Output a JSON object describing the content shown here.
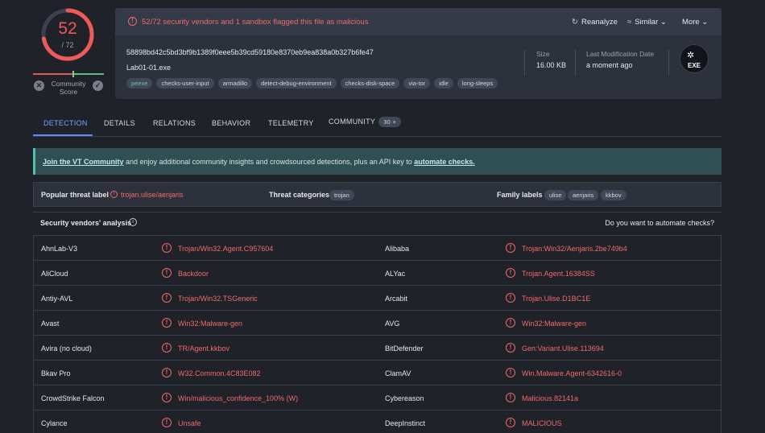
{
  "score": {
    "detected": "52",
    "total": "/ 72",
    "color": "#ef5a5a",
    "fraction": 0.722
  },
  "community": {
    "label": "Community Score"
  },
  "banner": {
    "message": "52/72 security vendors and 1 sandbox flagged this file as malicious",
    "actions": [
      {
        "icon": "reanalyze-icon",
        "glyph": "↻",
        "label": "Reanalyze"
      },
      {
        "icon": "similar-icon",
        "glyph": "≈",
        "label": "Similar ⌄"
      },
      {
        "icon": "more-icon",
        "glyph": "",
        "label": "More ⌄"
      }
    ]
  },
  "file": {
    "hash": "58898bd42c5bd3bf9b1389f0eee5b39cd59180e8370eb9ea838a0b327b6fe47",
    "name": "Lab01-01.exe",
    "tags": [
      "peexe",
      "checks-user-input",
      "armadillo",
      "detect-debug-environment",
      "checks-disk-space",
      "via-tor",
      "idle",
      "long-sleeps"
    ],
    "size_label": "Size",
    "size_value": "16.00 KB",
    "modified_label": "Last Modification Date",
    "modified_value": "a moment ago",
    "type_badge": "EXE"
  },
  "tabs": [
    {
      "label": "DETECTION"
    },
    {
      "label": "DETAILS"
    },
    {
      "label": "RELATIONS"
    },
    {
      "label": "BEHAVIOR"
    },
    {
      "label": "TELEMETRY"
    },
    {
      "label": "COMMUNITY",
      "badge": "30 +"
    }
  ],
  "join": {
    "link1": "Join the VT Community",
    "text": " and enjoy additional community insights and crowdsourced detections, plus an API key to ",
    "link2": "automate checks."
  },
  "threat": {
    "popular_label": "Popular threat label",
    "popular_value": "trojan.ulise/aenjaris",
    "categories_label": "Threat categories",
    "categories": [
      "trojan"
    ],
    "family_label": "Family labels",
    "families": [
      "ulise",
      "aenjaris",
      "kkbov"
    ]
  },
  "analysis": {
    "title": "Security vendors' analysis",
    "automate_question": "Do you want to automate checks?",
    "rows": [
      {
        "v1": "AhnLab-V3",
        "r1": "Trojan/Win32.Agent.C957604",
        "v2": "Alibaba",
        "r2": "Trojan:Win32/Aenjaris.2be749b4"
      },
      {
        "v1": "AliCloud",
        "r1": "Backdoor",
        "v2": "ALYac",
        "r2": "Trojan.Agent.16384SS"
      },
      {
        "v1": "Antiy-AVL",
        "r1": "Trojan/Win32.TSGeneric",
        "v2": "Arcabit",
        "r2": "Trojan.Ulise.D1BC1E"
      },
      {
        "v1": "Avast",
        "r1": "Win32:Malware-gen",
        "v2": "AVG",
        "r2": "Win32:Malware-gen"
      },
      {
        "v1": "Avira (no cloud)",
        "r1": "TR/Agent.kkbov",
        "v2": "BitDefender",
        "r2": "Gen:Variant.Ulise.113694"
      },
      {
        "v1": "Bkav Pro",
        "r1": "W32.Common.4C83E082",
        "v2": "ClamAV",
        "r2": "Win.Malware.Agent-6342616-0"
      },
      {
        "v1": "CrowdStrike Falcon",
        "r1": "Win/malicious_confidence_100% (W)",
        "v2": "Cybereason",
        "r2": "Malicious.82141a"
      },
      {
        "v1": "Cylance",
        "r1": "Unsafe",
        "v2": "DeepInstinct",
        "r2": "MALICIOUS"
      }
    ]
  },
  "colors": {
    "malicious": "#ef6b6b",
    "accent": "#5b8cff",
    "background": "#1f2229"
  }
}
